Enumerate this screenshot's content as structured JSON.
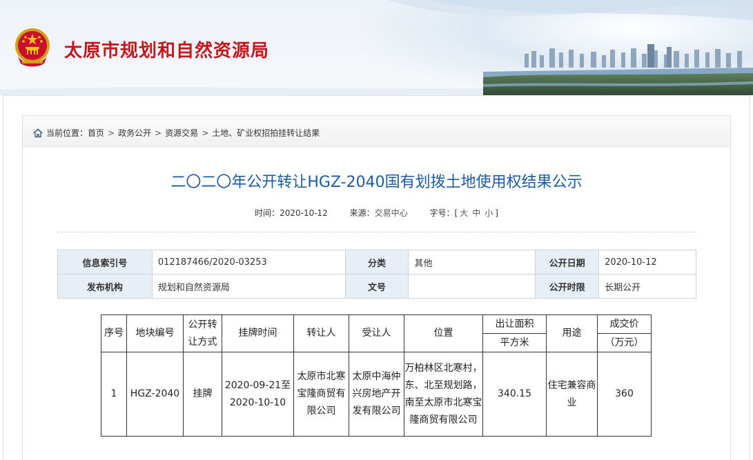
{
  "site": {
    "title": "太原市规划和自然资源局"
  },
  "breadcrumb": {
    "prefix": "当前位置：",
    "items": [
      "首页",
      "政务公开",
      "资源交易",
      "土地、矿业权招拍挂转让结果"
    ],
    "separator": ">"
  },
  "article": {
    "title": "二〇二〇年公开转让HGZ-2040国有划拨土地使用权结果公示",
    "time_label": "时间：",
    "time": "2020-10-12",
    "source_label": "来源：",
    "source": "交易中心",
    "fontsize_label": "字号：",
    "fontsize_open": "[",
    "fontsize_large": "大",
    "fontsize_medium": "中",
    "fontsize_small": "小",
    "fontsize_close": "]"
  },
  "info": {
    "index_label": "信息索引号",
    "index_value": "012187466/2020-03253",
    "category_label": "分类",
    "category_value": "其他",
    "date_label": "公开日期",
    "date_value": "2020-10-12",
    "publisher_label": "发布机构",
    "publisher_value": "规划和自然资源局",
    "docno_label": "文号",
    "docno_value": "",
    "period_label": "公开时限",
    "period_value": "长期公开"
  },
  "result_table": {
    "headers": {
      "seq": "序号",
      "plot_no": "地块编号",
      "method_l1": "公开转",
      "method_l2": "让方式",
      "listing_time": "挂牌时间",
      "transferor": "转让人",
      "transferee": "受让人",
      "location": "位置",
      "area": "出让面积",
      "area_unit": "平方米",
      "usage": "用途",
      "price": "成交价",
      "price_unit": "（万元）"
    },
    "row": {
      "seq": "1",
      "plot_no": "HGZ-2040",
      "method": "挂牌",
      "listing_time_l1": "2020-09-21至",
      "listing_time_l2": "2020-10-10",
      "transferor_l1": "太原市北寒",
      "transferor_l2": "宝隆商贸有",
      "transferor_l3": "限公司",
      "transferee_l1": "太原中海仲",
      "transferee_l2": "兴房地产开",
      "transferee_l3": "发有限公司",
      "location_l1": "万柏林区北寒村，",
      "location_l2": "东、北至规划路，",
      "location_l3": "南至太原市北寒宝",
      "location_l4": "隆商贸有限公司",
      "area": "340.15",
      "usage_l1": "住宅兼容商",
      "usage_l2": "业",
      "price": "360"
    }
  },
  "colors": {
    "brand_red": "#c4161c",
    "title_blue": "#1a5aa6",
    "info_key_bg": "#e8eef6"
  }
}
